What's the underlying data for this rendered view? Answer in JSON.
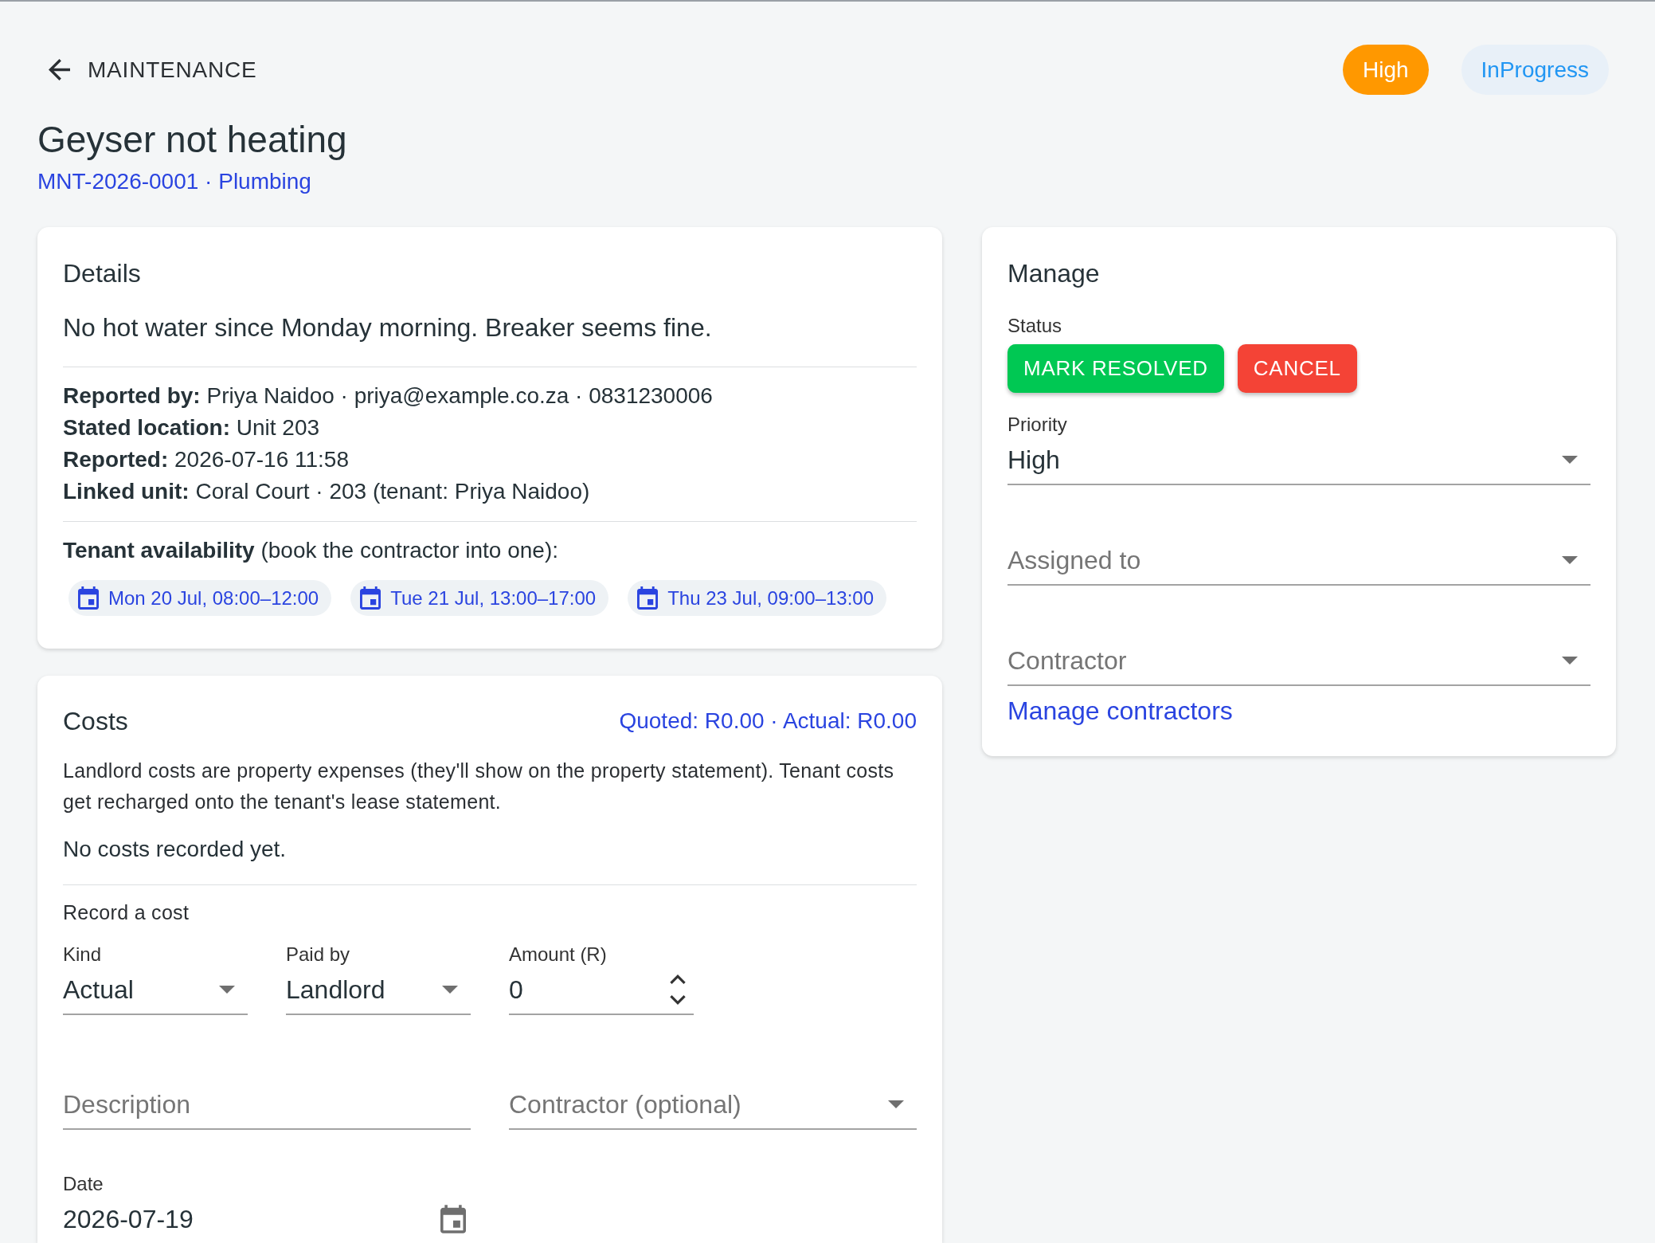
{
  "header": {
    "back_button": "MAINTENANCE",
    "badges": [
      {
        "kind": "priority",
        "label": "High"
      },
      {
        "kind": "status",
        "label": "InProgress"
      }
    ]
  },
  "title": "Geyser not heating",
  "subtitle": "MNT-2026-0001 · Plumbing",
  "details": {
    "heading": "Details",
    "description": "No hot water since Monday morning. Breaker seems fine.",
    "facts": [
      "**Reported by:** Priya Naidoo · priya@example.co.za · 0831230006",
      "**Stated location:** Unit 203",
      "**Reported:** 2026-07-16 11:58",
      "**Linked unit:** Coral Court · 203 (tenant: Priya Naidoo)"
    ],
    "availability_label": "**Tenant availability** (book the contractor into one):",
    "availability_slots": [
      "Mon 20 Jul, 08:00–12:00",
      "Tue 21 Jul, 13:00–17:00",
      "Thu 23 Jul, 09:00–13:00"
    ]
  },
  "costs": {
    "heading": "Costs",
    "summary": "Quoted: R0.00 · Actual: R0.00",
    "note": "Landlord costs are property expenses (they'll show on the property statement). Tenant costs get recharged onto the tenant's lease statement.",
    "empty_message": "No costs recorded yet.",
    "form_title": "Record a cost",
    "fields": [
      {
        "kind": "select",
        "label": "Kind",
        "value": "Actual"
      },
      {
        "kind": "select",
        "label": "Paid by",
        "value": "Landlord"
      },
      {
        "kind": "number",
        "label": "Amount (R)",
        "value": "0"
      },
      {
        "kind": "text",
        "placeholder": "Description"
      },
      {
        "kind": "select",
        "placeholder": "Contractor (optional)"
      },
      {
        "kind": "date",
        "label": "Date",
        "value": "2026-07-19"
      }
    ]
  },
  "manage": {
    "heading": "Manage",
    "status_label": "Status",
    "status_actions": [
      {
        "kind": "resolve",
        "label": "MARK RESOLVED"
      },
      {
        "kind": "cancel",
        "label": "CANCEL"
      }
    ],
    "fields": [
      {
        "kind": "select",
        "label": "Priority",
        "value": "High"
      },
      {
        "kind": "select",
        "placeholder": "Assigned to"
      },
      {
        "kind": "select",
        "placeholder": "Contractor"
      }
    ],
    "link": "Manage contractors"
  }
}
